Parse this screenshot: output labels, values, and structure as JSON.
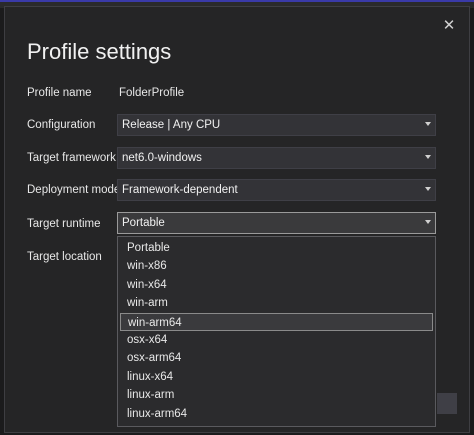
{
  "dialog": {
    "title": "Profile settings",
    "close_glyph": "✕"
  },
  "fields": {
    "profile_name": {
      "label": "Profile name",
      "value": "FolderProfile"
    },
    "configuration": {
      "label": "Configuration",
      "value": "Release | Any CPU"
    },
    "target_framework": {
      "label": "Target framework",
      "value": "net6.0-windows"
    },
    "deployment_mode": {
      "label": "Deployment mode",
      "value": "Framework-dependent"
    },
    "target_runtime": {
      "label": "Target runtime",
      "value": "Portable"
    },
    "target_location": {
      "label": "Target location"
    }
  },
  "runtime_dropdown": {
    "options": [
      "Portable",
      "win-x86",
      "win-x64",
      "win-arm",
      "win-arm64",
      "osx-x64",
      "osx-arm64",
      "linux-x64",
      "linux-arm",
      "linux-arm64"
    ],
    "highlighted": "win-arm64"
  },
  "icons": {
    "close": "close-icon",
    "dropdown_arrow": "chevron-down-icon"
  }
}
